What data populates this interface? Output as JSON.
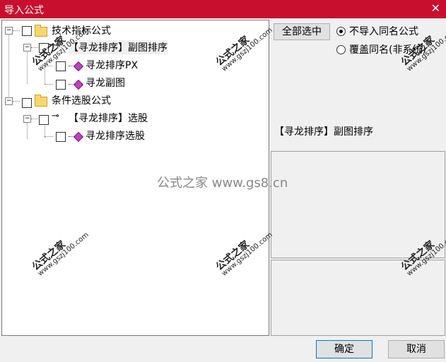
{
  "window": {
    "title": "导入公式",
    "close_symbol": "✕"
  },
  "tree": {
    "nodes": [
      {
        "label": "技术指标公式",
        "type": "folder"
      },
      {
        "label": "【寻龙排序】副图排序",
        "type": "key"
      },
      {
        "label": "寻龙排序PX",
        "type": "formula"
      },
      {
        "label": "寻龙副图",
        "type": "formula"
      },
      {
        "label": "条件选股公式",
        "type": "folder"
      },
      {
        "label": "【寻龙排序】选股",
        "type": "key"
      },
      {
        "label": "寻龙排序选股",
        "type": "formula"
      }
    ]
  },
  "controls": {
    "select_all_label": "全部选中",
    "radio_no_import_label": "不导入同名公式",
    "radio_overwrite_label": "覆盖同名(非系统)"
  },
  "info": {
    "text": "【寻龙排序】副图排序"
  },
  "footer": {
    "ok_label": "确定",
    "cancel_label": "取消"
  },
  "watermark": {
    "brand": "公式之家",
    "url": "www.gszj100.com",
    "center": "公式之家 www.gs8.cn"
  }
}
